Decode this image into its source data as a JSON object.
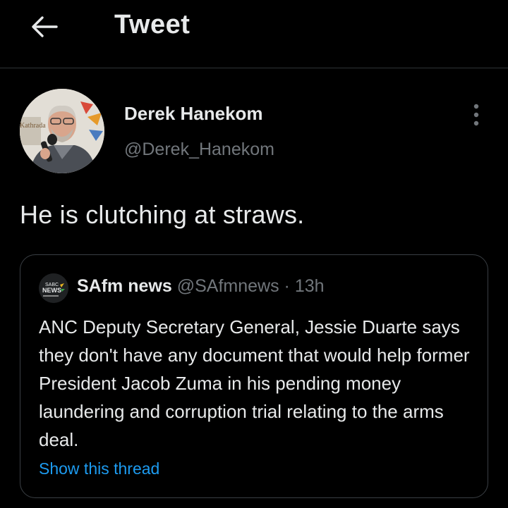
{
  "header": {
    "title": "Tweet",
    "back_icon": "arrow-left-icon"
  },
  "tweet": {
    "author_name": "Derek Hanekom",
    "author_handle": "@Derek_Hanekom",
    "more_icon": "more-vertical-icon",
    "text": "He is clutching at straws.",
    "avatar_sign_text": "Kathrada"
  },
  "quoted_tweet": {
    "logo_text_top": "SABC",
    "logo_text_bottom": "NEWS",
    "author_name": "SAfm news",
    "author_handle": "@SAfmnews",
    "separator": "·",
    "time": "13h",
    "text": "ANC Deputy Secretary General, Jessie Duarte says they don't have any document that would help former President Jacob Zuma in his pending money laundering and corruption trial relating to the arms deal.",
    "link_label": "Show this thread"
  },
  "colors": {
    "background": "#000000",
    "text_primary": "#e7e9ea",
    "text_secondary": "#71767b",
    "link": "#1d9bf0",
    "divider": "#2f3336"
  }
}
